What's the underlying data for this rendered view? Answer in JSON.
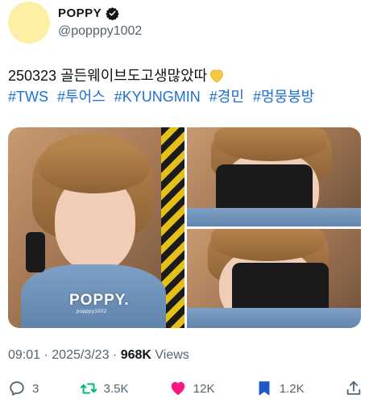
{
  "user": {
    "display_name": "POPPY",
    "handle": "@popppy1002",
    "verified_icon": "verified-badge-icon",
    "avatar_color": "#fdf0a4"
  },
  "tweet": {
    "text": "250323 골든웨이브도고생많았따",
    "emoji": "yellow-heart-icon",
    "hashtags": [
      "#TWS",
      "#투어스",
      "#KYUNGMIN",
      "#경민",
      "#멍뭉붕방"
    ]
  },
  "media": {
    "watermark": "POPPY.",
    "watermark_sub": "· popppy1002 ·",
    "images": [
      "photo-left",
      "photo-top-right",
      "photo-bottom-right"
    ]
  },
  "meta": {
    "time": "09:01",
    "separator": "·",
    "date": "2025/3/23",
    "views_count": "968K",
    "views_label": "Views"
  },
  "actions": {
    "reply_count": "3",
    "retweet_count": "3.5K",
    "like_count": "12K",
    "bookmark_count": "1.2K"
  },
  "colors": {
    "hashtag": "#1d6fd1",
    "retweet": "#00ba7c",
    "like": "#f91880",
    "bookmark": "#1d58c9",
    "secondary_text": "#536471"
  }
}
